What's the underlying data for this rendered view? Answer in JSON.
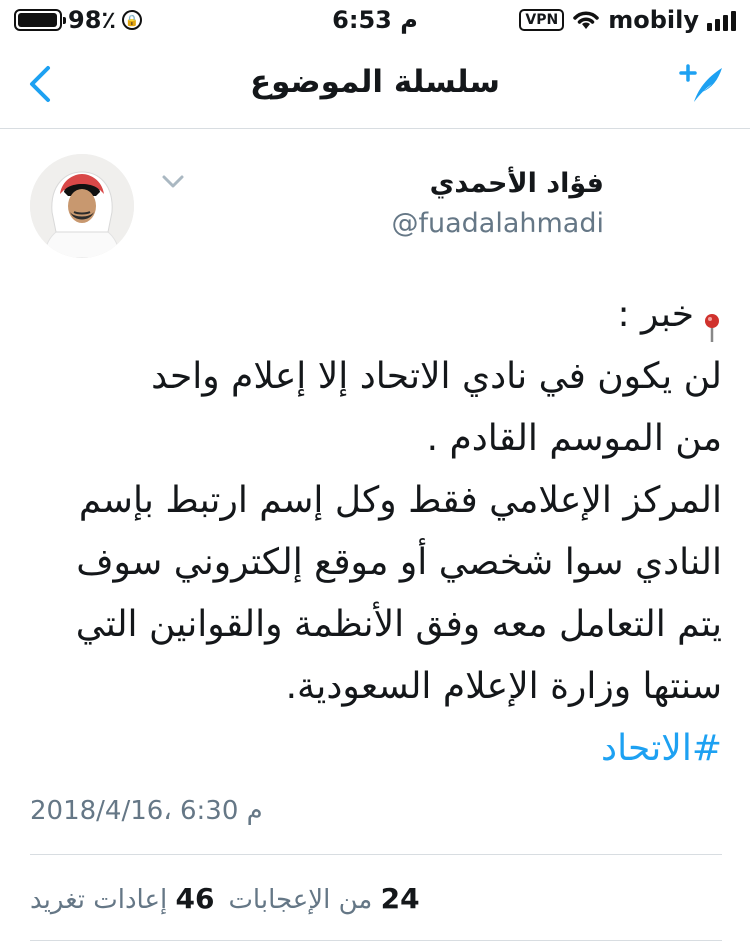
{
  "status_bar": {
    "battery": "98٪",
    "time": "6:53 م",
    "vpn": "VPN",
    "carrier": "mobily"
  },
  "nav": {
    "title": "سلسلة الموضوع"
  },
  "tweet": {
    "display_name": "فؤاد الأحمدي",
    "handle": "@fuadalahmadi",
    "lines": [
      "خبر :",
      "لن يكون في نادي الاتحاد إلا إعلام واحد",
      "من الموسم القادم .",
      "المركز الإعلامي فقط وكل إسم ارتبط بإسم",
      "النادي سوا شخصي أو موقع إلكتروني سوف",
      "يتم التعامل معه وفق الأنظمة والقوانين التي",
      "سنتها وزارة الإعلام السعودية."
    ],
    "hashtag": "#الاتحاد",
    "timestamp": "2018/4/16، 6:30 م"
  },
  "stats": {
    "retweets_count": "46",
    "retweets_label": "إعادات تغريد",
    "likes_count": "24",
    "likes_label": "من الإعجابات"
  },
  "colors": {
    "accent": "#1da1f2",
    "secondary_text": "#657786",
    "divider": "#d8dde1"
  }
}
